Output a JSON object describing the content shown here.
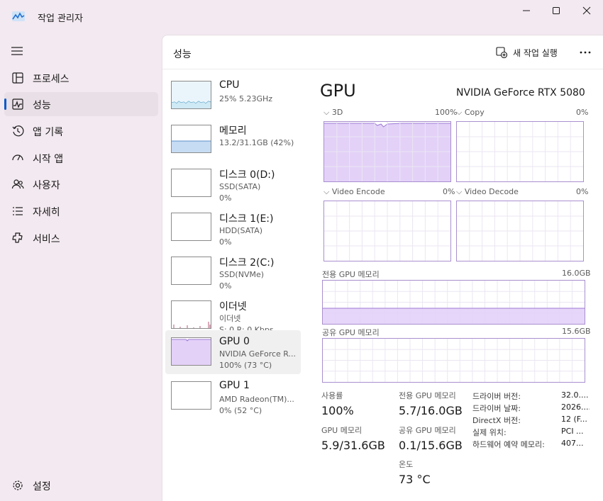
{
  "window": {
    "title": "작업 관리자"
  },
  "nav": {
    "items": [
      {
        "label": "프로세스",
        "icon": "processes-icon"
      },
      {
        "label": "성능",
        "icon": "performance-icon"
      },
      {
        "label": "앱 기록",
        "icon": "app-history-icon"
      },
      {
        "label": "시작 앱",
        "icon": "startup-apps-icon"
      },
      {
        "label": "사용자",
        "icon": "users-icon"
      },
      {
        "label": "자세히",
        "icon": "details-icon"
      },
      {
        "label": "서비스",
        "icon": "services-icon"
      }
    ],
    "settings": "설정",
    "active_index": 1
  },
  "header": {
    "title": "성능",
    "run_task": "새 작업 실행"
  },
  "resources": [
    {
      "name": "CPU",
      "sub1": "25%  5.23GHz",
      "sub2": ""
    },
    {
      "name": "메모리",
      "sub1": "13.2/31.1GB (42%)",
      "sub2": ""
    },
    {
      "name": "디스크 0(D:)",
      "sub1": "SSD(SATA)",
      "sub2": "0%"
    },
    {
      "name": "디스크 1(E:)",
      "sub1": "HDD(SATA)",
      "sub2": "0%"
    },
    {
      "name": "디스크 2(C:)",
      "sub1": "SSD(NVMe)",
      "sub2": "0%"
    },
    {
      "name": "이더넷",
      "sub1": "이더넷",
      "sub2": "S: 0  R: 0 Kbps"
    },
    {
      "name": "GPU 0",
      "sub1": "NVIDIA GeForce R...",
      "sub2": "100%  (73 °C)"
    },
    {
      "name": "GPU 1",
      "sub1": "AMD Radeon(TM)...",
      "sub2": "0%  (52 °C)"
    }
  ],
  "gpu": {
    "title": "GPU",
    "model": "NVIDIA GeForce RTX 5080",
    "engines": [
      {
        "label": "3D",
        "percent": "100%",
        "usage": 1.0
      },
      {
        "label": "Copy",
        "percent": "0%",
        "usage": 0.0
      },
      {
        "label": "Video Encode",
        "percent": "0%",
        "usage": 0.0
      },
      {
        "label": "Video Decode",
        "percent": "0%",
        "usage": 0.0
      }
    ],
    "dedicated_mem": {
      "label": "전용 GPU 메모리",
      "max": "16.0GB",
      "fill": 0.36
    },
    "shared_mem": {
      "label": "공유 GPU 메모리",
      "max": "15.6GB",
      "fill": 0.0
    },
    "stats": {
      "utilization_label": "사용률",
      "utilization": "100%",
      "dedicated_label": "전용 GPU 메모리",
      "dedicated": "5.7/16.0GB",
      "gpu_mem_label": "GPU 메모리",
      "gpu_mem": "5.9/31.6GB",
      "shared_label": "공유 GPU 메모리",
      "shared": "0.1/15.6GB",
      "temp_label": "온도",
      "temp": "73 °C"
    },
    "info": [
      {
        "key": "드라이버 버전:",
        "value": "32.0...."
      },
      {
        "key": "드라이버 날짜:",
        "value": "2026...."
      },
      {
        "key": "DirectX 버전:",
        "value": "12 (F..."
      },
      {
        "key": "실제 위치:",
        "value": "PCI ..."
      },
      {
        "key": "하드웨어 예약 메모리:",
        "value": "407..."
      }
    ]
  },
  "colors": {
    "accent": "#0a59c9",
    "gpu_fill": "#e3d1f8",
    "gpu_line": "#9d7ad4",
    "mem_fill": "#c6dcf3",
    "mem_line": "#5b8fc7",
    "cpu_line": "#3a8fb8"
  }
}
